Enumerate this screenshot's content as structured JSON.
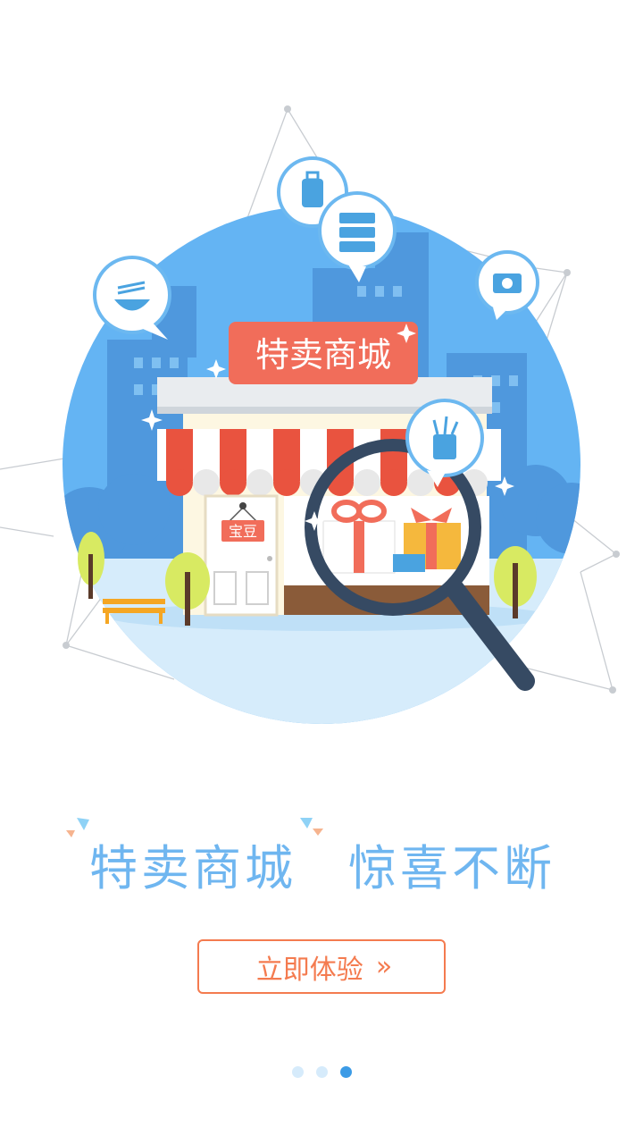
{
  "banner": {
    "shop_sign": "特卖商城",
    "door_sign": "宝豆"
  },
  "headline": {
    "left": "特卖商城",
    "right": "惊喜不断"
  },
  "cta": {
    "label": "立即体验",
    "arrow": "»"
  },
  "pager": {
    "count": 3,
    "current": 3
  },
  "colors": {
    "circle_bg": "#64b4f3",
    "accent_orange": "#f47b4f",
    "sign_red": "#f16d5a",
    "text_blue": "#6fb6f0",
    "dot_active": "#3c9be6",
    "dot_inactive": "#d6ebfb"
  },
  "icons": [
    "noodle-bowl-icon",
    "luggage-icon",
    "drawer-cabinet-icon",
    "camera-icon",
    "pen-cup-icon",
    "magnifier-icon",
    "gift-icon"
  ]
}
